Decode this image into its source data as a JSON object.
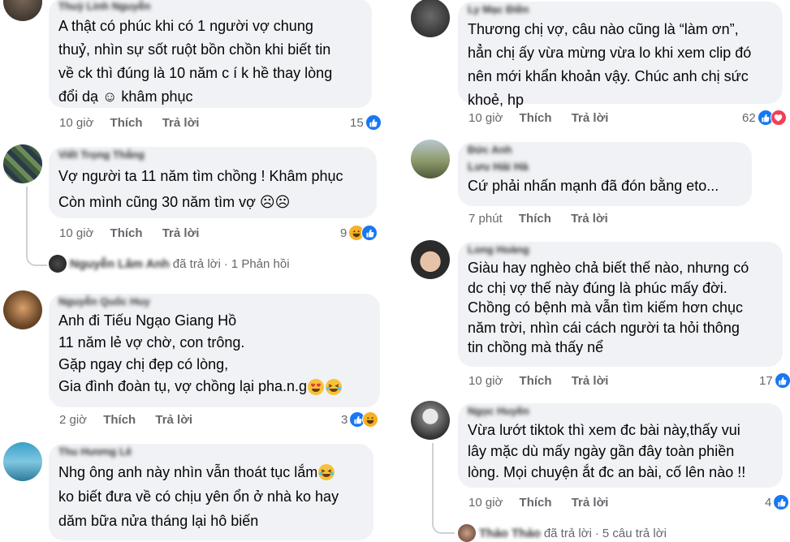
{
  "left": {
    "c1": {
      "author": "Thuỳ Linh Nguyễn",
      "lines": [
        "A thật có phúc khi có 1 người vợ chung",
        "thuỷ, nhìn sự sốt ruột bồn chồn khi biết tin",
        "về ck thì đúng là 10 năm c í k hề thay lòng",
        "đổi dạ ☺ khâm phục"
      ],
      "time": "10 giờ",
      "like": "Thích",
      "reply": "Trả lời",
      "count": "15"
    },
    "c2": {
      "author": "Viết Trọng Thắng",
      "lines": [
        "Vợ người ta 11 năm tìm chồng ! Khâm phục",
        "Còn mình cũng 30 năm tìm vợ ☹☹"
      ],
      "time": "10 giờ",
      "like": "Thích",
      "reply": "Trả lời",
      "count": "9",
      "thread": {
        "name": "Nguyễn Lâm Anh",
        "text": "đã trả lời",
        "sep": "·",
        "count": "1 Phản hồi"
      }
    },
    "c3": {
      "author": "Nguyễn Quốc Huy",
      "lines": [
        "Anh đi Tiếu Ngạo Giang Hồ",
        "11 năm lẻ vợ chờ, con trông.",
        "Gặp ngay chị đẹp có lòng,",
        "Gia đình đoàn tụ, vợ chồng lại pha.n.g"
      ],
      "time": "2 giờ",
      "like": "Thích",
      "reply": "Trả lời",
      "count": "3"
    },
    "c4": {
      "author": "Thu Hương Lê",
      "lines": [
        "Nhg ông anh này nhìn vẫn thoát tục lắm",
        "ko biết đưa về có chịu yên ổn ở nhà ko hay",
        "dăm bữa nửa tháng lại hô biến"
      ]
    }
  },
  "right": {
    "c1": {
      "author": "Ly Mạc Điền",
      "lines": [
        "Thương chị vợ, câu nào cũng là “làm ơn”,",
        "hẳn chị ấy vừa mừng vừa lo khi xem clip đó",
        "nên mới khẩn khoản vậy. Chúc anh chị sức",
        "khoẻ, hp"
      ],
      "time": "10 giờ",
      "like": "Thích",
      "reply": "Trả lời",
      "count": "62"
    },
    "c2": {
      "author": "Đức Anh",
      "mention": "Lưu Hải Hà",
      "lines": [
        "Cứ phải nhấn mạnh đã đón bằng eto..."
      ],
      "time": "7 phút",
      "like": "Thích",
      "reply": "Trả lời"
    },
    "c3": {
      "author": "Long Hoàng",
      "lines": [
        "Giàu hay nghèo chả biết thế nào, nhưng có",
        "dc chị vợ thế này đúng là phúc mấy đời.",
        "Chồng có bệnh mà vẫn tìm kiếm hơn chục",
        "năm trời, nhìn cái cách người ta hỏi thông",
        "tin chồng mà thấy nể"
      ],
      "time": "10 giờ",
      "like": "Thích",
      "reply": "Trả lời",
      "count": "17"
    },
    "c4": {
      "author": "Ngọc Huyền",
      "lines": [
        "Vừa lướt tiktok thì xem đc bài này,thấy vui",
        "lây mặc dù mấy ngày gần đây toàn  phiền",
        "lòng. Mọi chuyện ắt đc an bài, cố lên nào !!"
      ],
      "time": "10 giờ",
      "like": "Thích",
      "reply": "Trả lời",
      "count": "4",
      "thread": {
        "name": "Thảo Thảo",
        "text": "đã trả lời",
        "sep": "·",
        "count": "5 câu trả lời"
      }
    }
  },
  "colors": {
    "bubble": "#f0f2f5",
    "meta": "#65676b",
    "like_blue": "#1877f2",
    "haha": "#f7b125",
    "heart": "#f33e58"
  }
}
